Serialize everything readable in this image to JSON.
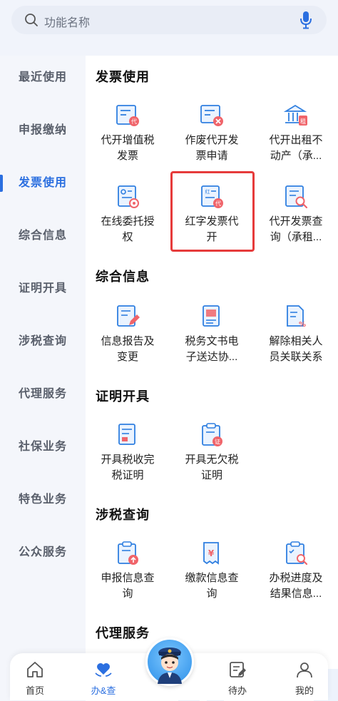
{
  "search": {
    "placeholder": "功能名称"
  },
  "sidebar": {
    "items": [
      {
        "label": "最近使用"
      },
      {
        "label": "申报缴纳"
      },
      {
        "label": "发票使用"
      },
      {
        "label": "综合信息"
      },
      {
        "label": "证明开具"
      },
      {
        "label": "涉税查询"
      },
      {
        "label": "代理服务"
      },
      {
        "label": "社保业务"
      },
      {
        "label": "特色业务"
      },
      {
        "label": "公众服务"
      }
    ],
    "active": "发票使用"
  },
  "sections": {
    "invoice": {
      "title": "发票使用",
      "tiles": [
        {
          "l1": "代开增值税",
          "l2": "发票"
        },
        {
          "l1": "作废代开发",
          "l2": "票申请"
        },
        {
          "l1": "代开出租不",
          "l2": "动产（承..."
        },
        {
          "l1": "在线委托授",
          "l2": "权"
        },
        {
          "l1": "红字发票代",
          "l2": "开"
        },
        {
          "l1": "代开发票查",
          "l2": "询（承租..."
        }
      ]
    },
    "info": {
      "title": "综合信息",
      "tiles": [
        {
          "l1": "信息报告及",
          "l2": "变更"
        },
        {
          "l1": "税务文书电",
          "l2": "子送达协..."
        },
        {
          "l1": "解除相关人",
          "l2": "员关联关系"
        }
      ]
    },
    "cert": {
      "title": "证明开具",
      "tiles": [
        {
          "l1": "开具税收完",
          "l2": "税证明"
        },
        {
          "l1": "开具无欠税",
          "l2": "证明"
        }
      ]
    },
    "query": {
      "title": "涉税查询",
      "tiles": [
        {
          "l1": "申报信息查",
          "l2": "询"
        },
        {
          "l1": "缴款信息查",
          "l2": "询"
        },
        {
          "l1": "办税进度及",
          "l2": "结果信息..."
        }
      ]
    },
    "agent": {
      "title": "代理服务"
    }
  },
  "nav": {
    "items": [
      {
        "label": "首页"
      },
      {
        "label": "办&查"
      },
      {
        "label": "待办"
      },
      {
        "label": "我的"
      }
    ],
    "active": "办&查"
  },
  "colors": {
    "accent": "#2b6fe0",
    "highlight": "#e63b3b",
    "icon": "#2f7fe0"
  }
}
